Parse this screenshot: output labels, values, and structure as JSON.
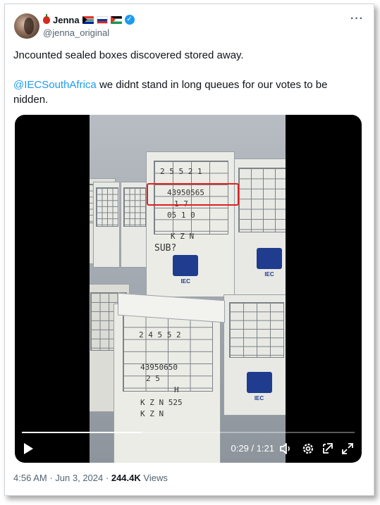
{
  "user": {
    "display_name": "Jenna",
    "handle": "@jenna_original",
    "emoji_icons": [
      "red-apple-icon",
      "south-africa-flag-icon",
      "russia-flag-icon",
      "palestine-flag-icon"
    ],
    "verified": true
  },
  "tweet": {
    "line1": "Jncounted sealed boxes discovered stored away.",
    "mention": "@IECSouthAfrica",
    "line2_rest": " we didnt stand in long queues for our votes to be",
    "line3": "nidden."
  },
  "video": {
    "current_time": "0:29",
    "separator": " / ",
    "duration": "1:21",
    "progress": 0.36,
    "box_texts": {
      "top_date": "2 5 5 2 1",
      "highlight_number": "43950565",
      "mid_a": "1 7",
      "mid_b": "05   1 0",
      "mid_c": "K Z N",
      "scribble": "SUB?",
      "front_row": "2 4 5 5 2",
      "front_number": "43950650",
      "front_a": "2 5",
      "front_b": "H",
      "front_c": "K Z N 525",
      "front_d": "K Z N"
    }
  },
  "footer": {
    "time": "4:56 AM",
    "dot": "·",
    "date": "Jun 3, 2024",
    "views_count": "244.4K",
    "views_label": "Views"
  },
  "colors": {
    "accent": "#1d9bf0",
    "text": "#0f1419",
    "muted": "#536471",
    "highlight_box": "#e02020"
  }
}
